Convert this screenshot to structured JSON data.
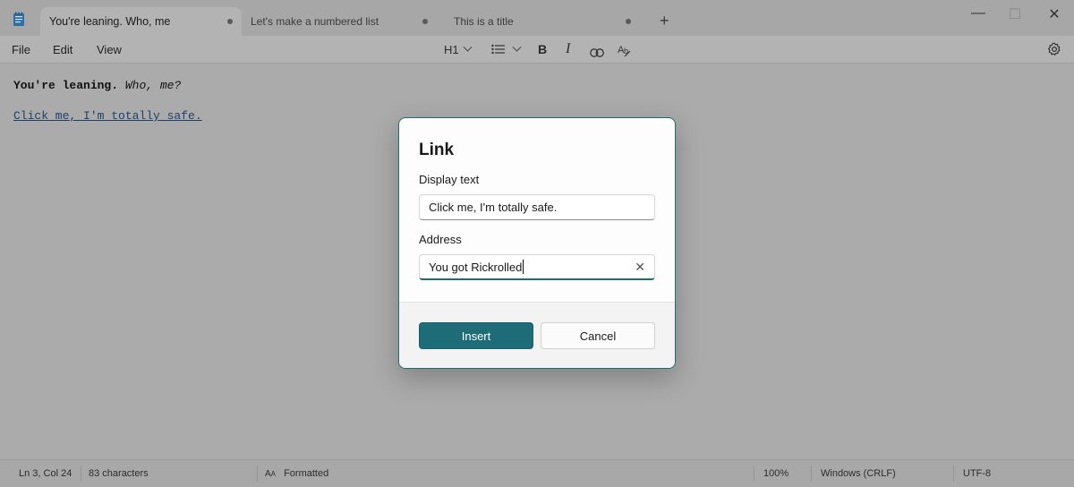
{
  "tabs": [
    {
      "label": "You're leaning. Who, me",
      "active": true
    },
    {
      "label": "Let's make a numbered list",
      "active": false
    },
    {
      "label": "This is a title",
      "active": false
    }
  ],
  "window_controls": {
    "minimize": "—",
    "maximize": "☐",
    "close": "✕"
  },
  "menu": {
    "file": "File",
    "edit": "Edit",
    "view": "View"
  },
  "toolbar": {
    "heading": "H1",
    "bold": "B",
    "italic": "I"
  },
  "document": {
    "line1_bold": "You're leaning.",
    "line1_italic": "Who, me?",
    "link_text": "Click me, I'm totally safe."
  },
  "dialog": {
    "title": "Link",
    "display_text_label": "Display text",
    "display_text_value": "Click me, I'm totally safe.",
    "address_label": "Address",
    "address_value": "You got Rickrolled",
    "insert_label": "Insert",
    "cancel_label": "Cancel"
  },
  "status": {
    "position": "Ln 3, Col 24",
    "characters": "83 characters",
    "format": "Formatted",
    "zoom": "100%",
    "line_ending": "Windows (CRLF)",
    "encoding": "UTF-8"
  },
  "colors": {
    "accent": "#1e6c78",
    "link": "#1f3f6a"
  }
}
